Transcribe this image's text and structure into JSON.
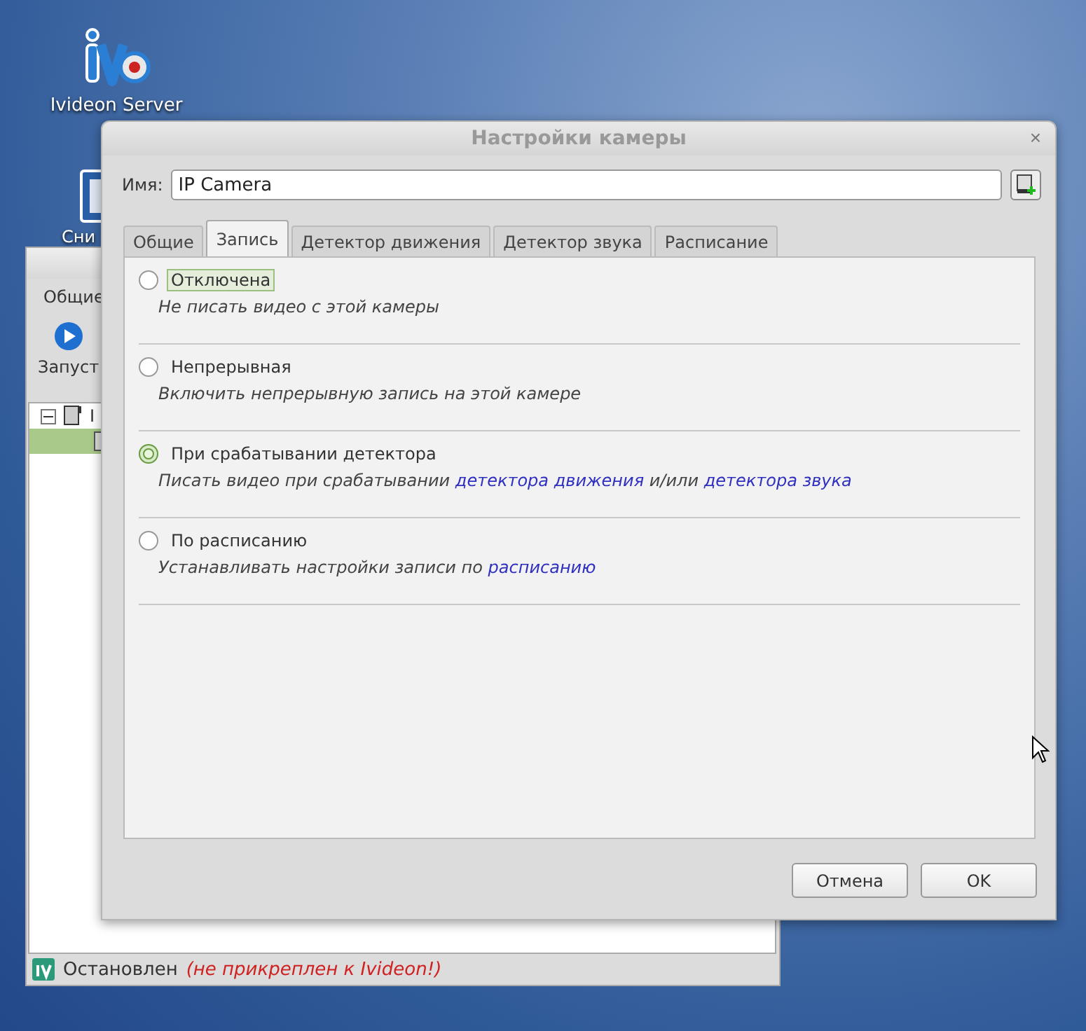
{
  "desktop_icons": [
    {
      "label": "Ivideon Server",
      "kind": "logo"
    },
    {
      "label": "Сни",
      "kind": "app"
    }
  ],
  "main_window": {
    "menu": [
      "Общие"
    ],
    "toolbar": [
      {
        "label": "Запуст"
      }
    ],
    "tree": [
      {
        "label": "I",
        "expanded": true,
        "children": [
          {
            "selected": true
          }
        ]
      }
    ],
    "status": {
      "state": "Остановлен",
      "warning": "(не прикреплен к Ivideon!)"
    }
  },
  "dialog": {
    "title": "Настройки камеры",
    "close": "×",
    "name_label": "Имя:",
    "name_value": "IP Camera",
    "tabs": [
      {
        "label": "Общие",
        "selected": false
      },
      {
        "label": "Запись",
        "selected": true
      },
      {
        "label": "Детектор движения",
        "selected": false
      },
      {
        "label": "Детектор звука",
        "selected": false
      },
      {
        "label": "Расписание",
        "selected": false
      }
    ],
    "options": [
      {
        "label": "Отключена",
        "selected": false,
        "focused": true,
        "description": [
          {
            "kind": "text",
            "text": "Не писать видео с этой камеры"
          }
        ]
      },
      {
        "label": "Непрерывная",
        "selected": false,
        "focused": false,
        "description": [
          {
            "kind": "text",
            "text": "Включить непрерывную запись на этой камере"
          }
        ]
      },
      {
        "label": "При срабатывании детектора",
        "selected": true,
        "focused": false,
        "description": [
          {
            "kind": "text",
            "text": "Писать видео при срабатывании "
          },
          {
            "kind": "link",
            "text": "детектора движения"
          },
          {
            "kind": "text",
            "text": " и/или "
          },
          {
            "kind": "link",
            "text": "детектора звука"
          }
        ]
      },
      {
        "label": "По расписанию",
        "selected": false,
        "focused": false,
        "description": [
          {
            "kind": "text",
            "text": "Устанавливать настройки записи по "
          },
          {
            "kind": "link",
            "text": "расписанию"
          }
        ]
      }
    ],
    "buttons": [
      "Отмена",
      "OK"
    ]
  }
}
